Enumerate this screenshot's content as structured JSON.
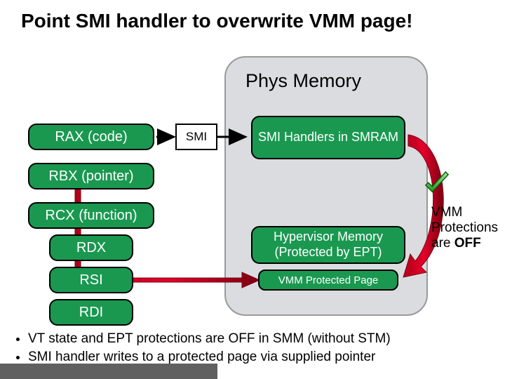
{
  "title": "Point SMI handler to overwrite VMM page!",
  "phys_memory_label": "Phys Memory",
  "registers": {
    "rax": "RAX (code)",
    "rbx": "RBX (pointer)",
    "rcx": "RCX (function)",
    "rdx": "RDX",
    "rsi": "RSI",
    "rdi": "RDI"
  },
  "smi_label": "SMI",
  "memory": {
    "smi_handlers": "SMI Handlers in SMRAM",
    "hypervisor": "Hypervisor Memory (Protected by EPT)",
    "vmm_page": "VMM Protected Page"
  },
  "vmm_note": {
    "line1": "VMM",
    "line2": "Protections",
    "line3_pre": "are ",
    "line3_bold": "OFF"
  },
  "bullets": [
    "VT state and EPT protections are OFF in SMM (without STM)",
    "SMI handler writes to a protected page via supplied pointer"
  ]
}
